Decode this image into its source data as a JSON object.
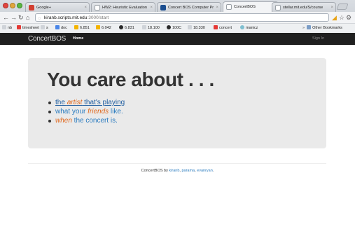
{
  "browser": {
    "tabs": [
      {
        "title": "Google+",
        "color": "#d23f31"
      },
      {
        "title": "HW2: Heuristic Evaluation",
        "color": "#9aa0a6"
      },
      {
        "title": "Concert BOS Computer Pr",
        "color": "#1a4d8f"
      },
      {
        "title": "ConcertBOS",
        "color": "#9aa0a6"
      },
      {
        "title": "stellar.mit.edu/S/course",
        "color": "#9aa0a6"
      }
    ],
    "address": {
      "host": "kiranb.scripts.mit.edu",
      "path": ":3000/start"
    },
    "bookmarks": [
      {
        "label": "nb",
        "color": "#cfd3d8"
      },
      {
        "label": "timesheet",
        "color": "#e53935"
      },
      {
        "label": "s",
        "color": "#cfd3d8"
      },
      {
        "label": "doc",
        "color": "#4a86e8"
      },
      {
        "label": "6.851",
        "color": "#f4b400"
      },
      {
        "label": "6.042",
        "color": "#f4b400"
      },
      {
        "label": "6.831",
        "color": "#2a2a2a"
      },
      {
        "label": "18.100",
        "color": "#cfd3d8"
      },
      {
        "label": "100C",
        "color": "#2a2a2a"
      },
      {
        "label": "18.330",
        "color": "#cfd3d8"
      },
      {
        "label": "concert",
        "color": "#e53935"
      },
      {
        "label": "manicz",
        "color": "#80bfd0"
      }
    ],
    "other_bookmarks": "Other Bookmarks"
  },
  "site": {
    "brand": "ConcertBOS",
    "nav_home": "Home",
    "sign_in": "Sign In",
    "hero": {
      "heading": "You care about . . .",
      "item1_prefix": "the ",
      "item1_em": "artist",
      "item1_suffix": " that's playing",
      "item2_prefix": "what your ",
      "item2_em": "friends",
      "item2_suffix": " like.",
      "item3_em": "when",
      "item3_suffix": " the concert is."
    },
    "footer": {
      "prefix": "ConcertBOS by ",
      "author1": "kiranb",
      "sep1": ", ",
      "author2": "parama",
      "sep2": ", ",
      "author3": "evanryan",
      "suffix": "."
    }
  }
}
